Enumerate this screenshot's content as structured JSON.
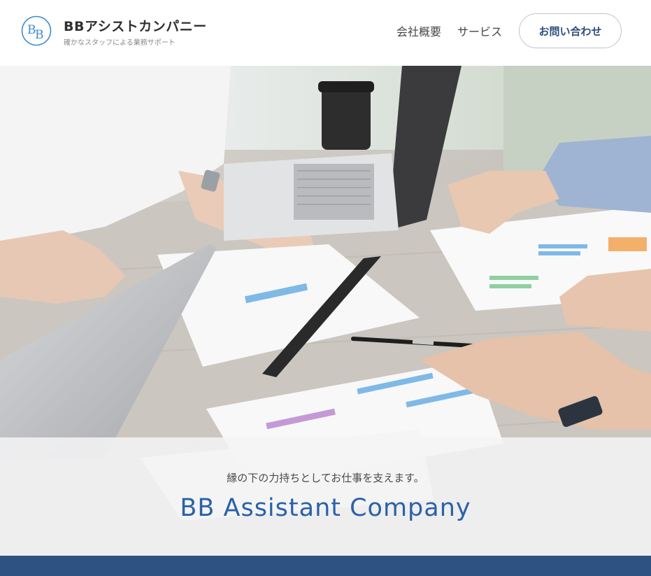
{
  "brand": {
    "name": "BBアシストカンパニー",
    "tagline": "確かなスタッフによる業務サポート",
    "logo_letters": "BB",
    "logo_icon": "bb-circle-logo"
  },
  "nav": {
    "items": [
      {
        "label": "会社概要"
      },
      {
        "label": "サービス"
      }
    ],
    "contact_label": "お問い合わせ"
  },
  "hero": {
    "image": "business-meeting-photo",
    "subtitle": "縁の下の力持ちとしてお仕事を支えます。",
    "title": "BB Assistant Company"
  },
  "colors": {
    "accent_blue": "#2a62a8",
    "band_navy": "#2e5282",
    "logo_blue": "#3c8cd0"
  }
}
